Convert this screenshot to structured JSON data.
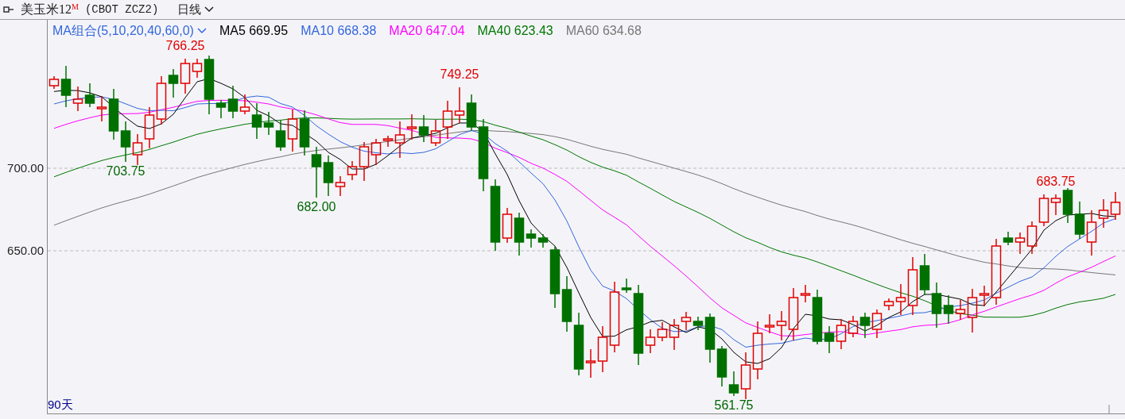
{
  "header": {
    "title": "美玉米12$^{M}$",
    "code": "(CBOT ZCZ2)",
    "period": "日线"
  },
  "ma_legend": {
    "group": "MA组合(5,10,20,40,60,0)",
    "items": [
      {
        "label": "MA5 669.95",
        "color": "#000000"
      },
      {
        "label": "MA10 668.38",
        "color": "#3366dd"
      },
      {
        "label": "MA20 647.04",
        "color": "#ff00ff"
      },
      {
        "label": "MA40 623.43",
        "color": "#007700"
      },
      {
        "label": "MA60 634.68",
        "color": "#777777"
      }
    ]
  },
  "y_axis": [
    "700.00",
    "650.00"
  ],
  "price_labels": [
    {
      "text": "766.25",
      "kind": "high"
    },
    {
      "text": "749.25",
      "kind": "high"
    },
    {
      "text": "703.75",
      "kind": "low"
    },
    {
      "text": "682.00",
      "kind": "low"
    },
    {
      "text": "561.75",
      "kind": "low"
    },
    {
      "text": "683.75",
      "kind": "high"
    }
  ],
  "range_label": "90天"
}
